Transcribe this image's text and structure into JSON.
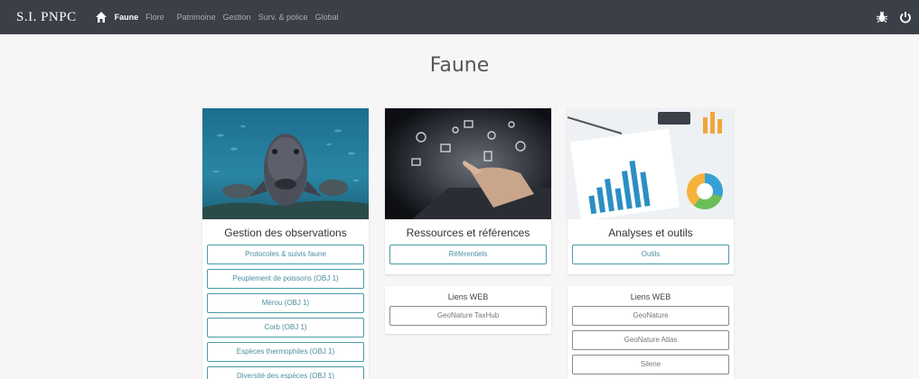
{
  "navbar": {
    "brand": "S.I. PNPC",
    "items": [
      "Faune",
      "Flore",
      "Patrimoine",
      "Gestion",
      "Surv. & police",
      "Global"
    ],
    "active": "Faune",
    "right_icons": [
      "bug-icon",
      "power-icon"
    ]
  },
  "page_title": "Faune",
  "columns": [
    {
      "title": "Gestion des observations",
      "image": "grouper-fish-photo",
      "buttons": [
        "Protocoles & suivis faune",
        "Peuplement de poissons (OBJ 1)",
        "Mérou (OBJ 1)",
        "Corb (OBJ 1)",
        "Espèces thermophiles (OBJ 1)",
        "Diversité des espèces (OBJ 1)"
      ]
    },
    {
      "title": "Ressources et références",
      "image": "tablet-touch-photo",
      "buttons": [
        "Référentiels"
      ],
      "links_title": "Liens WEB",
      "links": [
        "GeoNature TaxHub"
      ]
    },
    {
      "title": "Analyses et outils",
      "image": "charts-analytics-photo",
      "buttons": [
        "Outils"
      ],
      "links_title": "Liens WEB",
      "links": [
        "GeoNature",
        "GeoNature Atlas",
        "Silene"
      ]
    }
  ],
  "colors": {
    "navbar": "#3a3f48",
    "accent": "#4b9aa6",
    "background": "#f6f6f6"
  }
}
